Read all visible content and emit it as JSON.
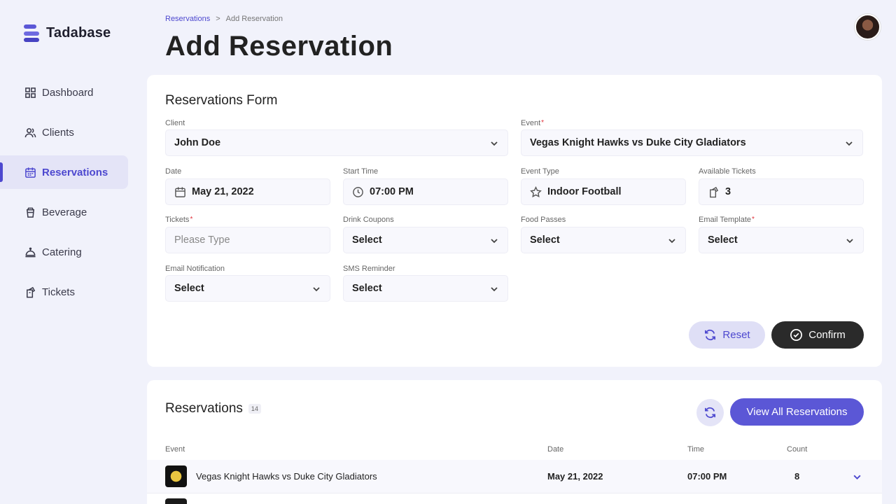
{
  "app": {
    "name": "Tadabase"
  },
  "sidebar": {
    "items": [
      {
        "label": "Dashboard",
        "icon": "grid-icon",
        "active": false
      },
      {
        "label": "Clients",
        "icon": "users-icon",
        "active": false
      },
      {
        "label": "Reservations",
        "icon": "calendar-icon",
        "active": true
      },
      {
        "label": "Beverage",
        "icon": "cup-icon",
        "active": false
      },
      {
        "label": "Catering",
        "icon": "cloche-icon",
        "active": false
      },
      {
        "label": "Tickets",
        "icon": "ticket-icon",
        "active": false
      }
    ]
  },
  "header": {
    "breadcrumb": {
      "parent": "Reservations",
      "separator": ">",
      "current": "Add Reservation"
    },
    "title": "Add Reservation"
  },
  "form": {
    "title": "Reservations Form",
    "client": {
      "label": "Client",
      "value": "John Doe"
    },
    "event": {
      "label": "Event",
      "required_mark": "*",
      "value": "Vegas Knight Hawks vs Duke City Gladiators"
    },
    "date": {
      "label": "Date",
      "value": "May 21, 2022"
    },
    "start_time": {
      "label": "Start Time",
      "value": "07:00 PM"
    },
    "event_type": {
      "label": "Event Type",
      "value": "Indoor Football"
    },
    "available_tickets": {
      "label": "Available Tickets",
      "value": "3"
    },
    "tickets": {
      "label": "Tickets",
      "required_mark": "*",
      "placeholder": "Please Type"
    },
    "drink_coupons": {
      "label": "Drink Coupons",
      "value": "Select"
    },
    "food_passes": {
      "label": "Food Passes",
      "value": "Select"
    },
    "email_template": {
      "label": "Email Template",
      "required_mark": "*",
      "value": "Select"
    },
    "email_notification": {
      "label": "Email Notification",
      "value": "Select"
    },
    "sms_reminder": {
      "label": "SMS Reminder",
      "value": "Select"
    },
    "reset_label": "Reset",
    "confirm_label": "Confirm"
  },
  "reservations": {
    "title": "Reservations",
    "count": "14",
    "view_all_label": "View All Reservations",
    "columns": {
      "event": "Event",
      "date": "Date",
      "time": "Time",
      "count": "Count"
    },
    "rows": [
      {
        "event": "Vegas Knight Hawks vs Duke City Gladiators",
        "date": "May 21, 2022",
        "time": "07:00 PM",
        "count": "8"
      }
    ]
  },
  "colors": {
    "accent": "#4d48cf",
    "background": "#f1f2fb",
    "dark_button": "#2a2a2a"
  }
}
